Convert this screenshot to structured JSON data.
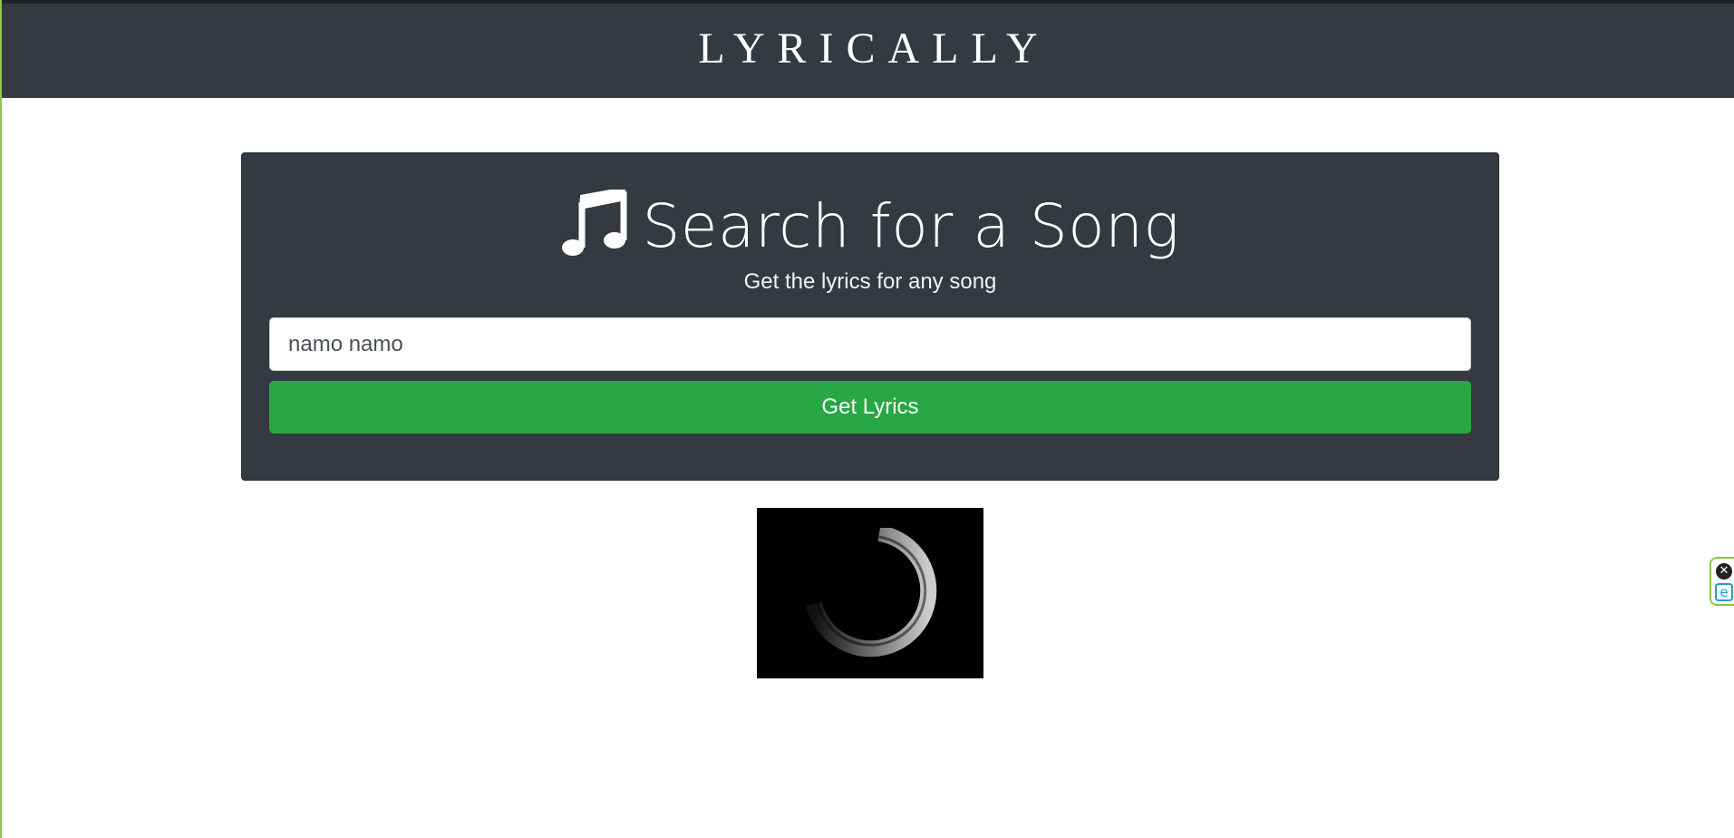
{
  "navbar": {
    "brand": "LYRICALLY"
  },
  "search": {
    "icon": "music-icon",
    "title": "Search for a Song",
    "subtitle": "Get the lyrics for any song",
    "input_value": "namo namo",
    "button_label": "Get Lyrics"
  },
  "loader": {
    "icon": "loading-spinner-icon"
  },
  "extension": {
    "close_glyph": "✕",
    "logo_glyph": "e"
  },
  "colors": {
    "navbar_bg": "#343a40",
    "panel_bg": "#343a40",
    "button_green": "#28a745",
    "accent_lime": "#8dc63f",
    "extension_blue": "#1a9fd9"
  }
}
